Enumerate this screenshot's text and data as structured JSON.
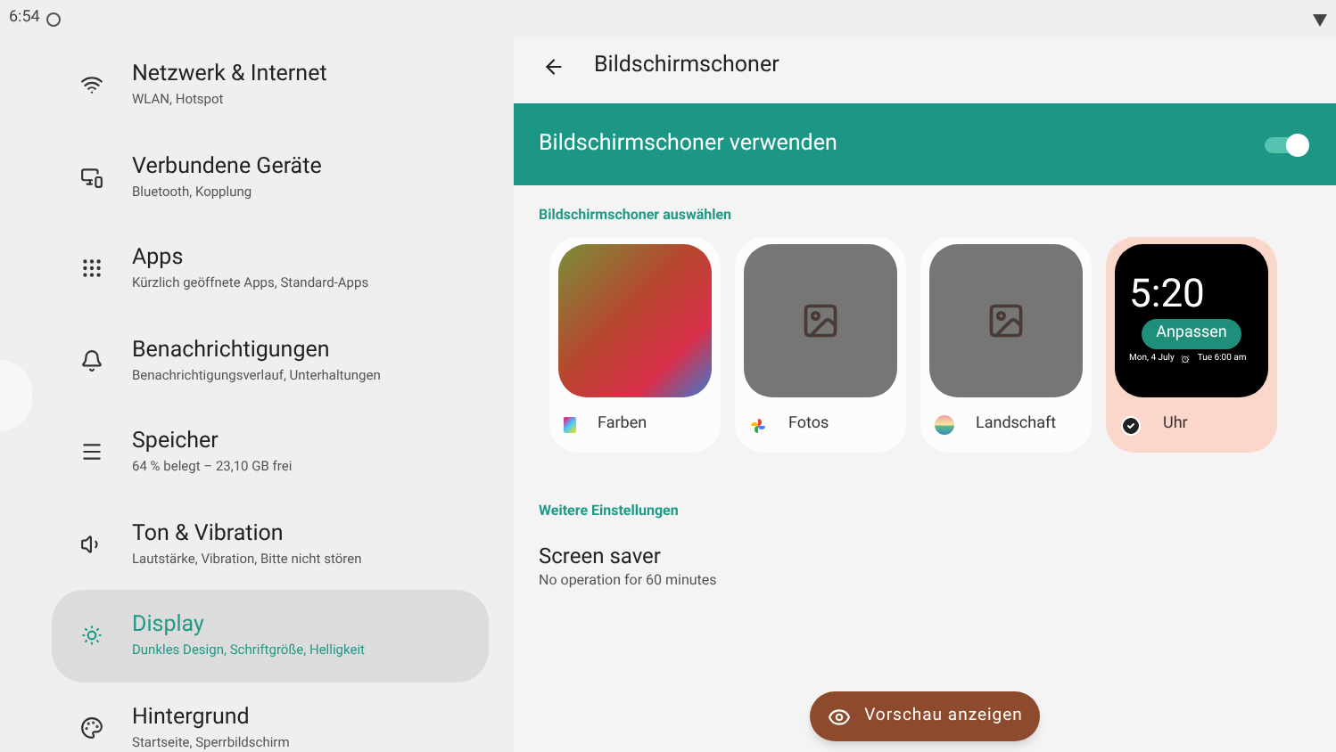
{
  "status_bar": {
    "time": "6:54"
  },
  "sidebar": {
    "items": [
      {
        "kind": "wifi",
        "title": "Netzwerk & Internet",
        "subtitle": "WLAN, Hotspot",
        "selected": false
      },
      {
        "kind": "devices",
        "title": "Verbundene Geräte",
        "subtitle": "Bluetooth, Kopplung",
        "selected": false
      },
      {
        "kind": "apps",
        "title": "Apps",
        "subtitle": "Kürzlich geöffnete Apps, Standard-Apps",
        "selected": false
      },
      {
        "kind": "bell",
        "title": "Benachrichtigungen",
        "subtitle": "Benachrichtigungsverlauf, Unterhaltungen",
        "selected": false
      },
      {
        "kind": "storage",
        "title": "Speicher",
        "subtitle": "64 % belegt – 23,10 GB frei",
        "selected": false
      },
      {
        "kind": "sound",
        "title": "Ton & Vibration",
        "subtitle": "Lautstärke, Vibration, Bitte nicht stören",
        "selected": false
      },
      {
        "kind": "display",
        "title": "Display",
        "subtitle": "Dunkles Design, Schriftgröße, Helligkeit",
        "selected": true
      },
      {
        "kind": "palette",
        "title": "Hintergrund",
        "subtitle": "Startseite, Sperrbildschirm",
        "selected": false
      }
    ]
  },
  "page": {
    "title": "Bildschirmschoner",
    "main_switch": {
      "label": "Bildschirmschoner verwenden",
      "on": true
    },
    "choose_heading": "Bildschirmschoner auswählen",
    "savers": [
      {
        "kind": "colors",
        "label": "Farben",
        "selected": false
      },
      {
        "kind": "photos",
        "label": "Fotos",
        "selected": false
      },
      {
        "kind": "landscape",
        "label": "Landschaft",
        "selected": false
      },
      {
        "kind": "clock",
        "label": "Uhr",
        "selected": true,
        "time": "5:20",
        "date": "Mon, 4 July",
        "alarm": "Tue 6:00 am",
        "customize": "Anpassen"
      }
    ],
    "more_heading": "Weitere Einstellungen",
    "setting": {
      "title": "Screen saver",
      "subtitle": "No operation for 60 minutes"
    },
    "preview_button": "Vorschau anzeigen"
  }
}
